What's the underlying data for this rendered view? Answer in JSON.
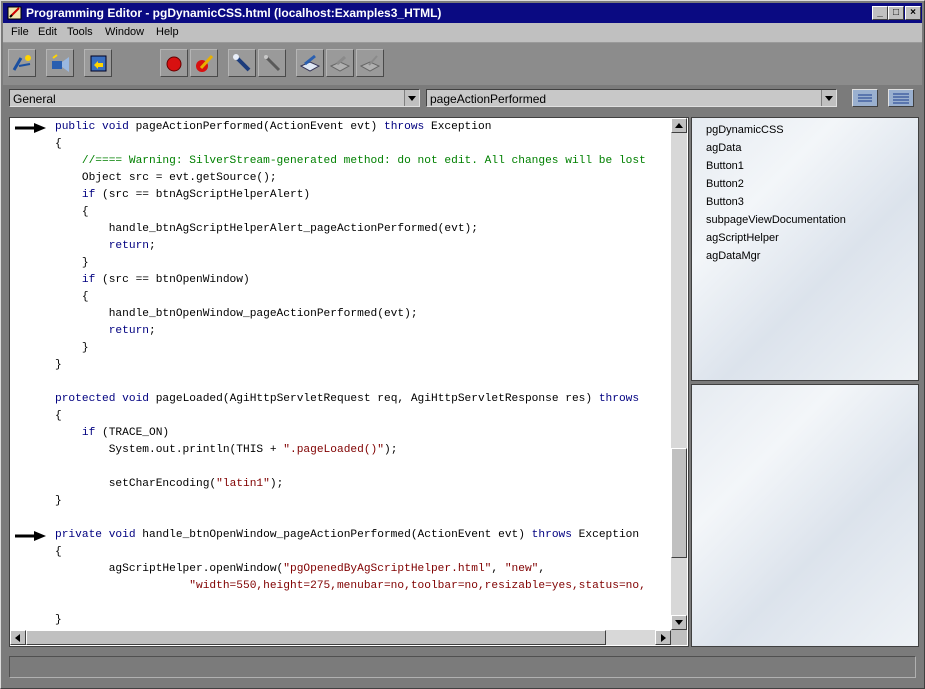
{
  "window": {
    "title": "Programming Editor - pgDynamicCSS.html  (localhost:Examples3_HTML)",
    "controls": [
      "_",
      "□",
      "×"
    ]
  },
  "menu": [
    "File",
    "Edit",
    "Tools",
    "Window",
    "Help"
  ],
  "toolbar": {
    "buttons": [
      {
        "icon": "compile-icon"
      },
      {
        "icon": "run-icon"
      },
      {
        "icon": "export-icon"
      },
      {
        "icon": "record-icon"
      },
      {
        "icon": "edit-icon"
      },
      {
        "icon": "flashlight-icon"
      },
      {
        "icon": "tool-icon"
      },
      {
        "icon": "open-book-icon"
      },
      {
        "icon": "book-icon"
      },
      {
        "icon": "book-edit-icon"
      }
    ]
  },
  "selectors": {
    "object_combo": "General",
    "event_combo": "pageActionPerformed"
  },
  "code": [
    {
      "parts": [
        [
          "kw",
          "public void "
        ],
        [
          "n",
          "pageActionPerformed(ActionEvent evt) "
        ],
        [
          "kw",
          "throws "
        ],
        [
          "n",
          "Exception"
        ]
      ]
    },
    {
      "parts": [
        [
          "n",
          "{"
        ]
      ]
    },
    {
      "parts": [
        [
          "cm",
          "    //==== Warning: SilverStream-generated method: do not edit. All changes will be lost"
        ]
      ]
    },
    {
      "parts": [
        [
          "n",
          "    Object src = evt.getSource();"
        ]
      ]
    },
    {
      "parts": [
        [
          "kw",
          "    if "
        ],
        [
          "n",
          "(src == btnAgScriptHelperAlert)"
        ]
      ]
    },
    {
      "parts": [
        [
          "n",
          "    {"
        ]
      ]
    },
    {
      "parts": [
        [
          "n",
          "        handle_btnAgScriptHelperAlert_pageActionPerformed(evt);"
        ]
      ]
    },
    {
      "parts": [
        [
          "kw",
          "        return"
        ],
        [
          "n",
          ";"
        ]
      ]
    },
    {
      "parts": [
        [
          "n",
          "    }"
        ]
      ]
    },
    {
      "parts": [
        [
          "kw",
          "    if "
        ],
        [
          "n",
          "(src == btnOpenWindow)"
        ]
      ]
    },
    {
      "parts": [
        [
          "n",
          "    {"
        ]
      ]
    },
    {
      "parts": [
        [
          "n",
          "        handle_btnOpenWindow_pageActionPerformed(evt);"
        ]
      ]
    },
    {
      "parts": [
        [
          "kw",
          "        return"
        ],
        [
          "n",
          ";"
        ]
      ]
    },
    {
      "parts": [
        [
          "n",
          "    }"
        ]
      ]
    },
    {
      "parts": [
        [
          "n",
          "}"
        ]
      ]
    },
    {
      "parts": []
    },
    {
      "parts": [
        [
          "kw",
          "protected void "
        ],
        [
          "n",
          "pageLoaded(AgiHttpServletRequest req, AgiHttpServletResponse res) "
        ],
        [
          "kw",
          "throws"
        ]
      ]
    },
    {
      "parts": [
        [
          "n",
          "{"
        ]
      ]
    },
    {
      "parts": [
        [
          "kw",
          "    if "
        ],
        [
          "n",
          "(TRACE_ON)"
        ]
      ]
    },
    {
      "parts": [
        [
          "n",
          "        System.out.println(THIS + "
        ],
        [
          "str",
          "\".pageLoaded()\""
        ],
        [
          "n",
          ");"
        ]
      ]
    },
    {
      "parts": []
    },
    {
      "parts": [
        [
          "n",
          "        setCharEncoding("
        ],
        [
          "str",
          "\"latin1\""
        ],
        [
          "n",
          ");"
        ]
      ]
    },
    {
      "parts": [
        [
          "n",
          "}"
        ]
      ]
    },
    {
      "parts": []
    },
    {
      "parts": [
        [
          "kw",
          "private void "
        ],
        [
          "n",
          "handle_btnOpenWindow_pageActionPerformed(ActionEvent evt) "
        ],
        [
          "kw",
          "throws "
        ],
        [
          "n",
          "Exception"
        ]
      ]
    },
    {
      "parts": [
        [
          "n",
          "{"
        ]
      ]
    },
    {
      "parts": [
        [
          "n",
          "        agScriptHelper.openWindow("
        ],
        [
          "str",
          "\"pgOpenedByAgScriptHelper.html\""
        ],
        [
          "n",
          ", "
        ],
        [
          "str",
          "\"new\""
        ],
        [
          "n",
          ","
        ]
      ]
    },
    {
      "parts": [
        [
          "str",
          "                    \"width=550,height=275,menubar=no,toolbar=no,resizable=yes,status=no,"
        ]
      ]
    },
    {
      "parts": []
    },
    {
      "parts": [
        [
          "n",
          "}"
        ]
      ]
    }
  ],
  "page_controls": [
    "pgDynamicCSS",
    "agData",
    "Button1",
    "Button2",
    "Button3",
    "subpageViewDocumentation",
    "agScriptHelper",
    "agDataMgr"
  ]
}
